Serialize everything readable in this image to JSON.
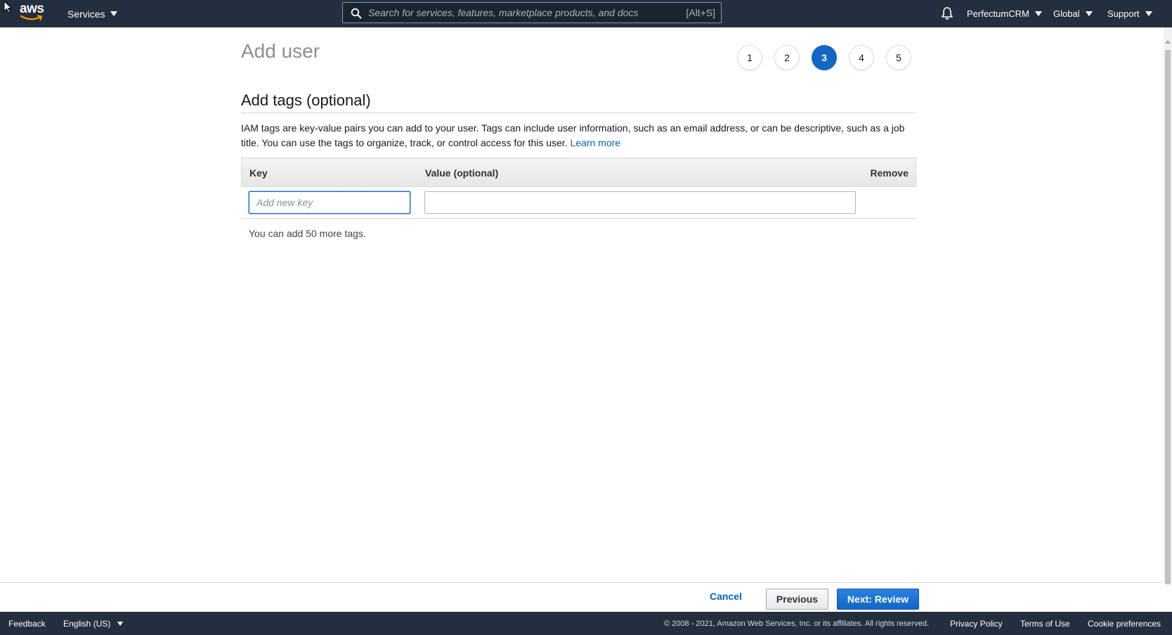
{
  "header": {
    "logo_text": "aws",
    "services_label": "Services",
    "search_placeholder": "Search for services, features, marketplace products, and docs",
    "search_shortcut": "[Alt+S]",
    "account_label": "PerfectumCRM",
    "region_label": "Global",
    "support_label": "Support"
  },
  "page": {
    "title": "Add user",
    "steps": [
      "1",
      "2",
      "3",
      "4",
      "5"
    ],
    "active_step": 3
  },
  "tags_section": {
    "title": "Add tags (optional)",
    "description": "IAM tags are key-value pairs you can add to your user. Tags can include user information, such as an email address, or can be descriptive, such as a job title. You can use the tags to organize, track, or control access for this user.",
    "learn_more_label": "Learn more",
    "columns": {
      "key": "Key",
      "value": "Value (optional)",
      "remove": "Remove"
    },
    "row": {
      "key_value": "",
      "key_placeholder": "Add new key",
      "value_value": ""
    },
    "remaining_text": "You can add 50 more tags."
  },
  "actions": {
    "cancel_label": "Cancel",
    "previous_label": "Previous",
    "next_label": "Next: Review"
  },
  "footer": {
    "feedback_label": "Feedback",
    "language_label": "English (US)",
    "copyright": "© 2008 - 2021, Amazon Web Services, Inc. or its affiliates. All rights reserved.",
    "privacy_label": "Privacy Policy",
    "terms_label": "Terms of Use",
    "cookie_label": "Cookie preferences"
  },
  "colors": {
    "nav_bg": "#232f3e",
    "accent": "#1266c5",
    "link": "#0066c0"
  }
}
